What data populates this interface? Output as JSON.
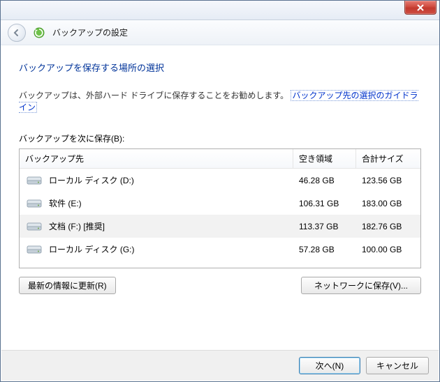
{
  "header": {
    "title": "バックアップの設定"
  },
  "content": {
    "heading": "バックアップを保存する場所の選択",
    "intro_text": "バックアップは、外部ハード ドライブに保存することをお勧めします。",
    "intro_link": "バックアップ先の選択のガイドライン",
    "list_label": "バックアップを次に保存(B):"
  },
  "table": {
    "columns": {
      "dest": "バックアップ先",
      "free": "空き領域",
      "total": "合計サイズ"
    },
    "rows": [
      {
        "name": "ローカル ディスク (D:)",
        "free": "46.28 GB",
        "total": "123.56 GB",
        "selected": false
      },
      {
        "name": "软件 (E:)",
        "free": "106.31 GB",
        "total": "183.00 GB",
        "selected": false
      },
      {
        "name": "文档 (F:) [推奨]",
        "free": "113.37 GB",
        "total": "182.76 GB",
        "selected": true
      },
      {
        "name": "ローカル ディスク (G:)",
        "free": "57.28 GB",
        "total": "100.00 GB",
        "selected": false
      }
    ]
  },
  "buttons": {
    "refresh": "最新の情報に更新(R)",
    "network": "ネットワークに保存(V)...",
    "next": "次へ(N)",
    "cancel": "キャンセル"
  }
}
